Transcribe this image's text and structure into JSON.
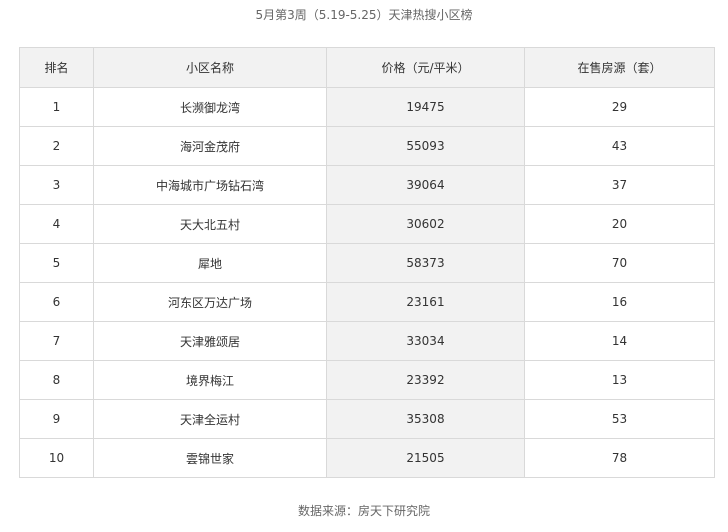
{
  "title": "5月第3周（5.19-5.25）天津热搜小区榜",
  "table": {
    "headers": [
      "排名",
      "小区名称",
      "价格（元/平米）",
      "在售房源（套）"
    ],
    "rows": [
      [
        "1",
        "长濒御龙湾",
        "19475",
        "29"
      ],
      [
        "2",
        "海河金茂府",
        "55093",
        "43"
      ],
      [
        "3",
        "中海城市广场钻石湾",
        "39064",
        "37"
      ],
      [
        "4",
        "天大北五村",
        "30602",
        "20"
      ],
      [
        "5",
        "犀地",
        "58373",
        "70"
      ],
      [
        "6",
        "河东区万达广场",
        "23161",
        "16"
      ],
      [
        "7",
        "天津雅颂居",
        "33034",
        "14"
      ],
      [
        "8",
        "境界梅江",
        "23392",
        "13"
      ],
      [
        "9",
        "天津全运村",
        "35308",
        "53"
      ],
      [
        "10",
        "雲锦世家",
        "21505",
        "78"
      ]
    ]
  },
  "source": "数据来源：房天下研究院"
}
